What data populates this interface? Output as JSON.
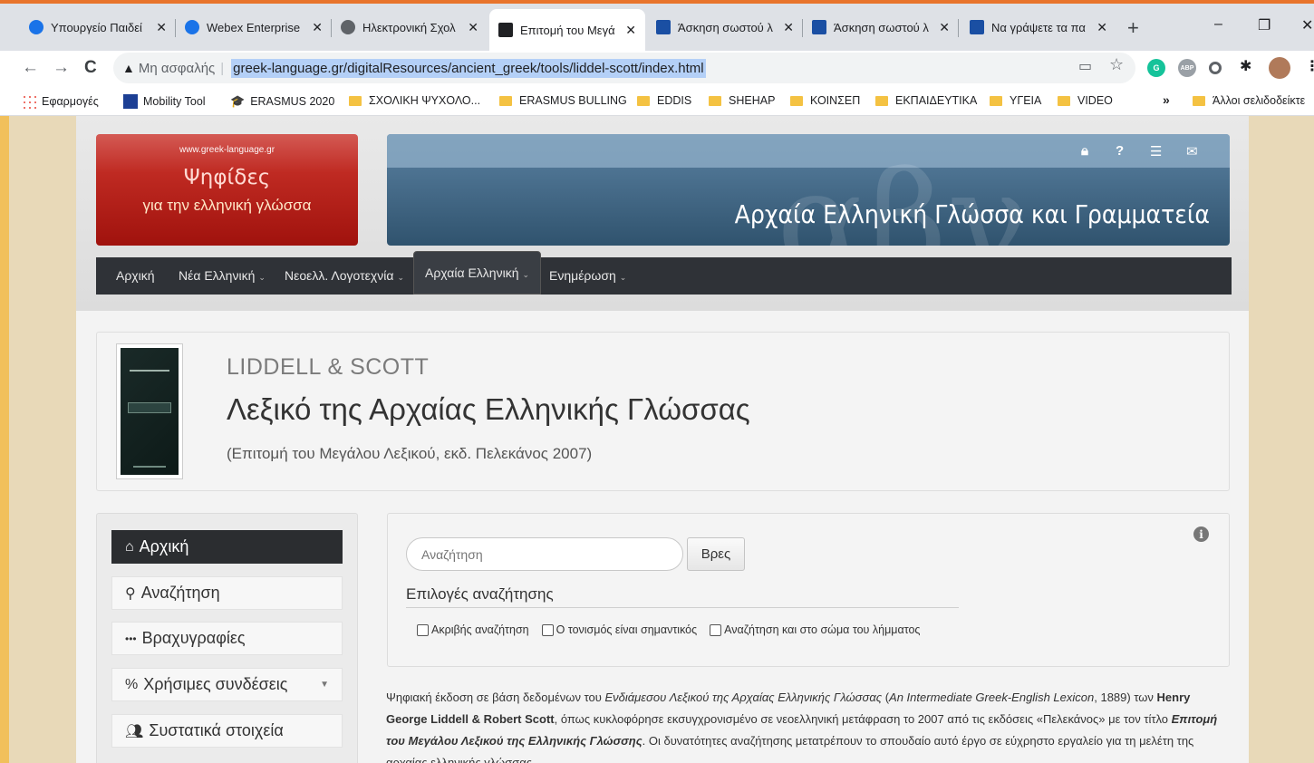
{
  "browser": {
    "tabs": [
      {
        "title": "Υπουργείο Παιδεί",
        "favicon_color": "#1a73e8",
        "active": false
      },
      {
        "title": "Webex Enterprise",
        "favicon_color": "#1a73e8",
        "active": false
      },
      {
        "title": "Ηλεκτρονική Σχολ",
        "favicon_color": "#5f6368",
        "active": false
      },
      {
        "title": "Επιτομή του Μεγά",
        "favicon_color": "#202124",
        "active": true
      },
      {
        "title": "Άσκηση σωστού λ",
        "favicon_color": "#1a4fa3",
        "active": false
      },
      {
        "title": "Άσκηση σωστού λ",
        "favicon_color": "#1a4fa3",
        "active": false
      },
      {
        "title": "Να γράψετε τα πα",
        "favicon_color": "#1a4fa3",
        "active": false
      }
    ],
    "new_tab": "+",
    "window_controls": {
      "minimize": "–",
      "maximize": "❐",
      "close": "✕"
    },
    "nav": {
      "back": "←",
      "forward": "→",
      "reload": "C"
    },
    "omnibox": {
      "security": "Μη ασφαλής",
      "url": "greek-language.gr/digitalResources/ancient_greek/tools/liddel-scott/index.html"
    },
    "bookmarks": [
      {
        "label": "Εφαρμογές",
        "type": "apps"
      },
      {
        "label": "Mobility Tool",
        "type": "eu"
      },
      {
        "label": "ERASMUS 2020",
        "type": "cap"
      },
      {
        "label": "ΣΧΟΛΙΚΗ ΨΥΧΟΛΟ...",
        "type": "folder"
      },
      {
        "label": "ERASMUS BULLING",
        "type": "folder"
      },
      {
        "label": "EDDIS",
        "type": "folder"
      },
      {
        "label": "SHEHAP",
        "type": "folder"
      },
      {
        "label": "ΚΟΙΝΣΕΠ",
        "type": "folder"
      },
      {
        "label": "ΕΚΠΑΙΔΕΥΤΙΚΑ",
        "type": "folder"
      },
      {
        "label": "ΥΓΕΙΑ",
        "type": "folder"
      },
      {
        "label": "VIDEO",
        "type": "folder"
      }
    ],
    "bookmarks_more": "»",
    "other_bookmarks": "Άλλοι σελιδοδείκτε"
  },
  "site": {
    "logo": {
      "url_text": "www.greek-language.gr",
      "title": "Ψηφίδες",
      "subtitle": "για την ελληνική γλώσσα"
    },
    "banner_title": "Αρχαία Ελληνική Γλώσσα και Γραμματεία",
    "nav": [
      {
        "label": "Αρχική",
        "has_dropdown": false,
        "active": false
      },
      {
        "label": "Νέα Ελληνική",
        "has_dropdown": true,
        "active": false
      },
      {
        "label": "Νεοελλ. Λογοτεχνία",
        "has_dropdown": true,
        "active": false
      },
      {
        "label": "Αρχαία Ελληνική",
        "has_dropdown": true,
        "active": true
      },
      {
        "label": "Ενημέρωση",
        "has_dropdown": true,
        "active": false
      }
    ],
    "header": {
      "label": "LIDDELL & SCOTT",
      "title": "Λεξικό της Αρχαίας Ελληνικής Γλώσσας",
      "subtitle": "(Επιτομή του Μεγάλου Λεξικού, εκδ. Πελεκάνος 2007)"
    },
    "sidebar": [
      {
        "label": "Αρχική",
        "icon": "home-icon",
        "selected": true
      },
      {
        "label": "Αναζήτηση",
        "icon": "search-icon",
        "selected": false
      },
      {
        "label": "Βραχυγραφίες",
        "icon": "ellipsis-icon",
        "selected": false
      },
      {
        "label": "Χρήσιμες συνδέσεις",
        "icon": "link-icon",
        "selected": false,
        "has_dropdown": true
      },
      {
        "label": "Συστατικά στοιχεία",
        "icon": "users-icon",
        "selected": false
      }
    ],
    "search": {
      "placeholder": "Αναζήτηση",
      "button": "Βρες",
      "options_title": "Επιλογές αναζήτησης",
      "options": [
        "Ακριβής αναζήτηση",
        "Ο τονισμός είναι σημαντικός",
        "Αναζήτηση και στο σώμα του λήμματος"
      ]
    },
    "description": {
      "part1": "Ψηφιακή έκδοση σε βάση δεδομένων του ",
      "italic1": "Ενδιάμεσου Λεξικού της Αρχαίας Ελληνικής Γλώσσας",
      "part2": " (",
      "italic2": "An Intermediate Greek-English Lexicon",
      "part3": ", 1889) των ",
      "bold1": "Henry George Liddell & Robert Scott",
      "part4": ", όπως κυκλοφόρησε εκσυγχρονισμένο σε νεοελληνική μετάφραση το 2007 από τις εκδόσεις «Πελεκάνος» με τον τίτλο ",
      "bolditalic": "Επιτομή του Μεγάλου Λεξικού της Ελληνικής Γλώσσης",
      "part5": ". Οι δυνατότητες αναζήτησης μετατρέπουν το σπουδαίο αυτό έργο σε εύχρηστο εργαλείο για τη μελέτη της αρχαίας ελληνικής γλώσσας."
    }
  }
}
